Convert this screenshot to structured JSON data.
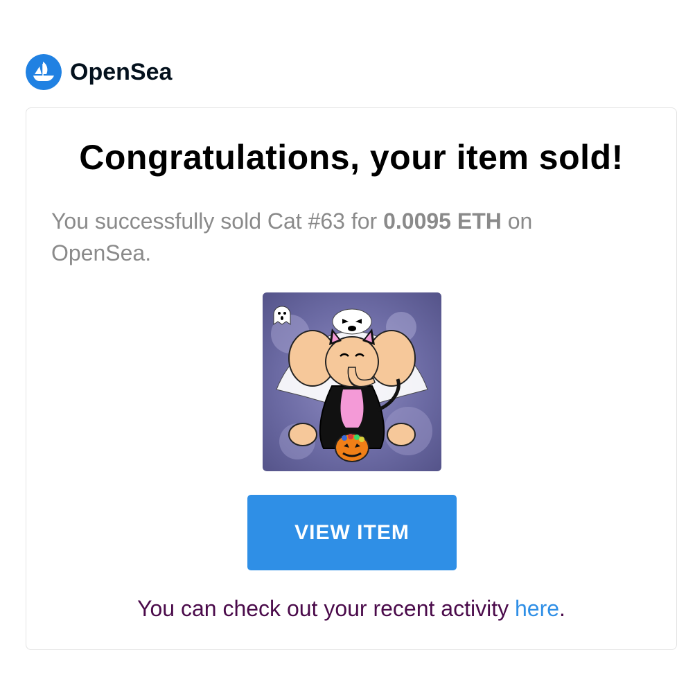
{
  "brand": {
    "name": "OpenSea",
    "logo_icon": "opensea-ship-icon",
    "logo_color": "#2081e2"
  },
  "email": {
    "headline": "Congratulations, your item sold!",
    "message_prefix": "You successfully sold Cat #63 for ",
    "price": "0.0095 ETH",
    "message_suffix": " on OpenSea.",
    "item_image": "cartoon-elephant-in-cat-costume-halloween-nft",
    "button_label": "VIEW ITEM",
    "button_color": "#2f8fe6",
    "activity_prefix": "You can check out your recent activity ",
    "activity_link": "here",
    "activity_suffix": "."
  }
}
